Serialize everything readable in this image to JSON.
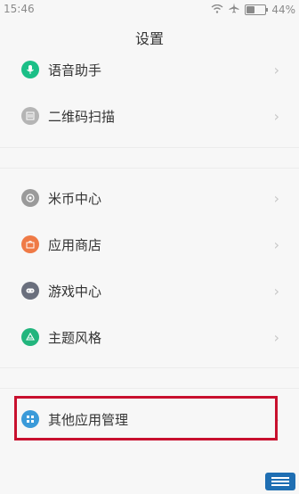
{
  "status": {
    "time": "15:46",
    "battery_text": "44%",
    "battery_level": 0.44
  },
  "title": "设置",
  "rows": [
    {
      "label": "语音助手",
      "icon": "microphone-icon",
      "color": "#1bbf87"
    },
    {
      "label": "二维码扫描",
      "icon": "qr-scan-icon",
      "color": "#b5b5b5"
    },
    {
      "label": "米币中心",
      "icon": "coin-icon",
      "color": "#9a9a9a"
    },
    {
      "label": "应用商店",
      "icon": "store-icon",
      "color": "#ef7a46"
    },
    {
      "label": "游戏中心",
      "icon": "gamepad-icon",
      "color": "#6a6f7d"
    },
    {
      "label": "主题风格",
      "icon": "theme-icon",
      "color": "#22b57d"
    },
    {
      "label": "其他应用管理",
      "icon": "apps-grid-icon",
      "color": "#3a9ad9"
    }
  ]
}
